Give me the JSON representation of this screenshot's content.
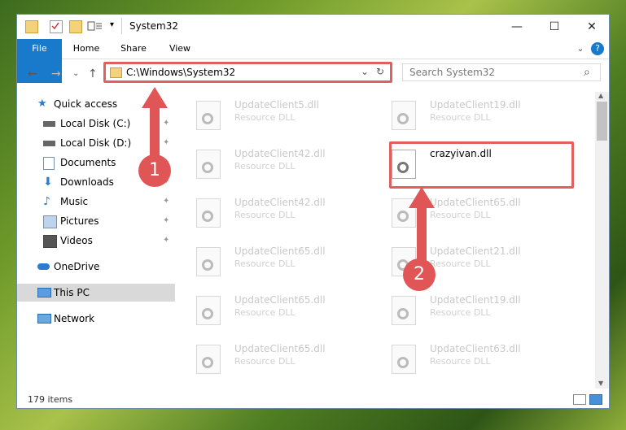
{
  "window": {
    "title": "System32",
    "minimize": "—",
    "maximize": "☐",
    "close": "✕"
  },
  "ribbon": {
    "tabs": [
      "File",
      "Home",
      "Share",
      "View"
    ],
    "expand": "⌄",
    "help": "?"
  },
  "nav": {
    "back": "←",
    "forward": "→",
    "recent": "⌄",
    "up": "↑"
  },
  "address": {
    "path": "C:\\Windows\\System32",
    "dropdown": "⌄",
    "refresh": "↻"
  },
  "search": {
    "placeholder": "Search System32",
    "icon": "⌕"
  },
  "sidebar": {
    "items": [
      {
        "label": "Quick access",
        "icon": "star-icon",
        "pinned": false
      },
      {
        "label": "Local Disk (C:)",
        "icon": "drive-icon",
        "pinned": true
      },
      {
        "label": "Local Disk (D:)",
        "icon": "drive-icon",
        "pinned": true
      },
      {
        "label": "Documents",
        "icon": "documents-icon",
        "pinned": true
      },
      {
        "label": "Downloads",
        "icon": "download-icon",
        "pinned": true
      },
      {
        "label": "Music",
        "icon": "music-icon",
        "pinned": true
      },
      {
        "label": "Pictures",
        "icon": "pictures-icon",
        "pinned": true
      },
      {
        "label": "Videos",
        "icon": "videos-icon",
        "pinned": true
      },
      {
        "label": "OneDrive",
        "icon": "cloud-icon",
        "pinned": false
      },
      {
        "label": "This PC",
        "icon": "computer-icon",
        "pinned": false
      },
      {
        "label": "Network",
        "icon": "network-icon",
        "pinned": false
      }
    ],
    "pin_glyph": "📌"
  },
  "files": [
    {
      "name": "UpdateClient5.dll",
      "type": "Resource DLL"
    },
    {
      "name": "UpdateClient19.dll",
      "type": "Resource DLL"
    },
    {
      "name": "UpdateClient42.dll",
      "type": "Resource DLL"
    },
    {
      "name": "crazyivan.dll",
      "type": ""
    },
    {
      "name": "UpdateClient42.dll",
      "type": "Resource DLL"
    },
    {
      "name": "UpdateClient65.dll",
      "type": "Resource DLL"
    },
    {
      "name": "UpdateClient65.dll",
      "type": "Resource DLL"
    },
    {
      "name": "UpdateClient21.dll",
      "type": "Resource DLL"
    },
    {
      "name": "UpdateClient65.dll",
      "type": "Resource DLL"
    },
    {
      "name": "UpdateClient19.dll",
      "type": "Resource DLL"
    },
    {
      "name": "UpdateClient65.dll",
      "type": "Resource DLL"
    },
    {
      "name": "UpdateClient63.dll",
      "type": "Resource DLL"
    }
  ],
  "status": {
    "count": "179 items"
  },
  "annotations": {
    "step1": "1",
    "step2": "2"
  },
  "colors": {
    "accent": "#1979ca",
    "highlight": "#e06060",
    "badge": "#e05555"
  }
}
